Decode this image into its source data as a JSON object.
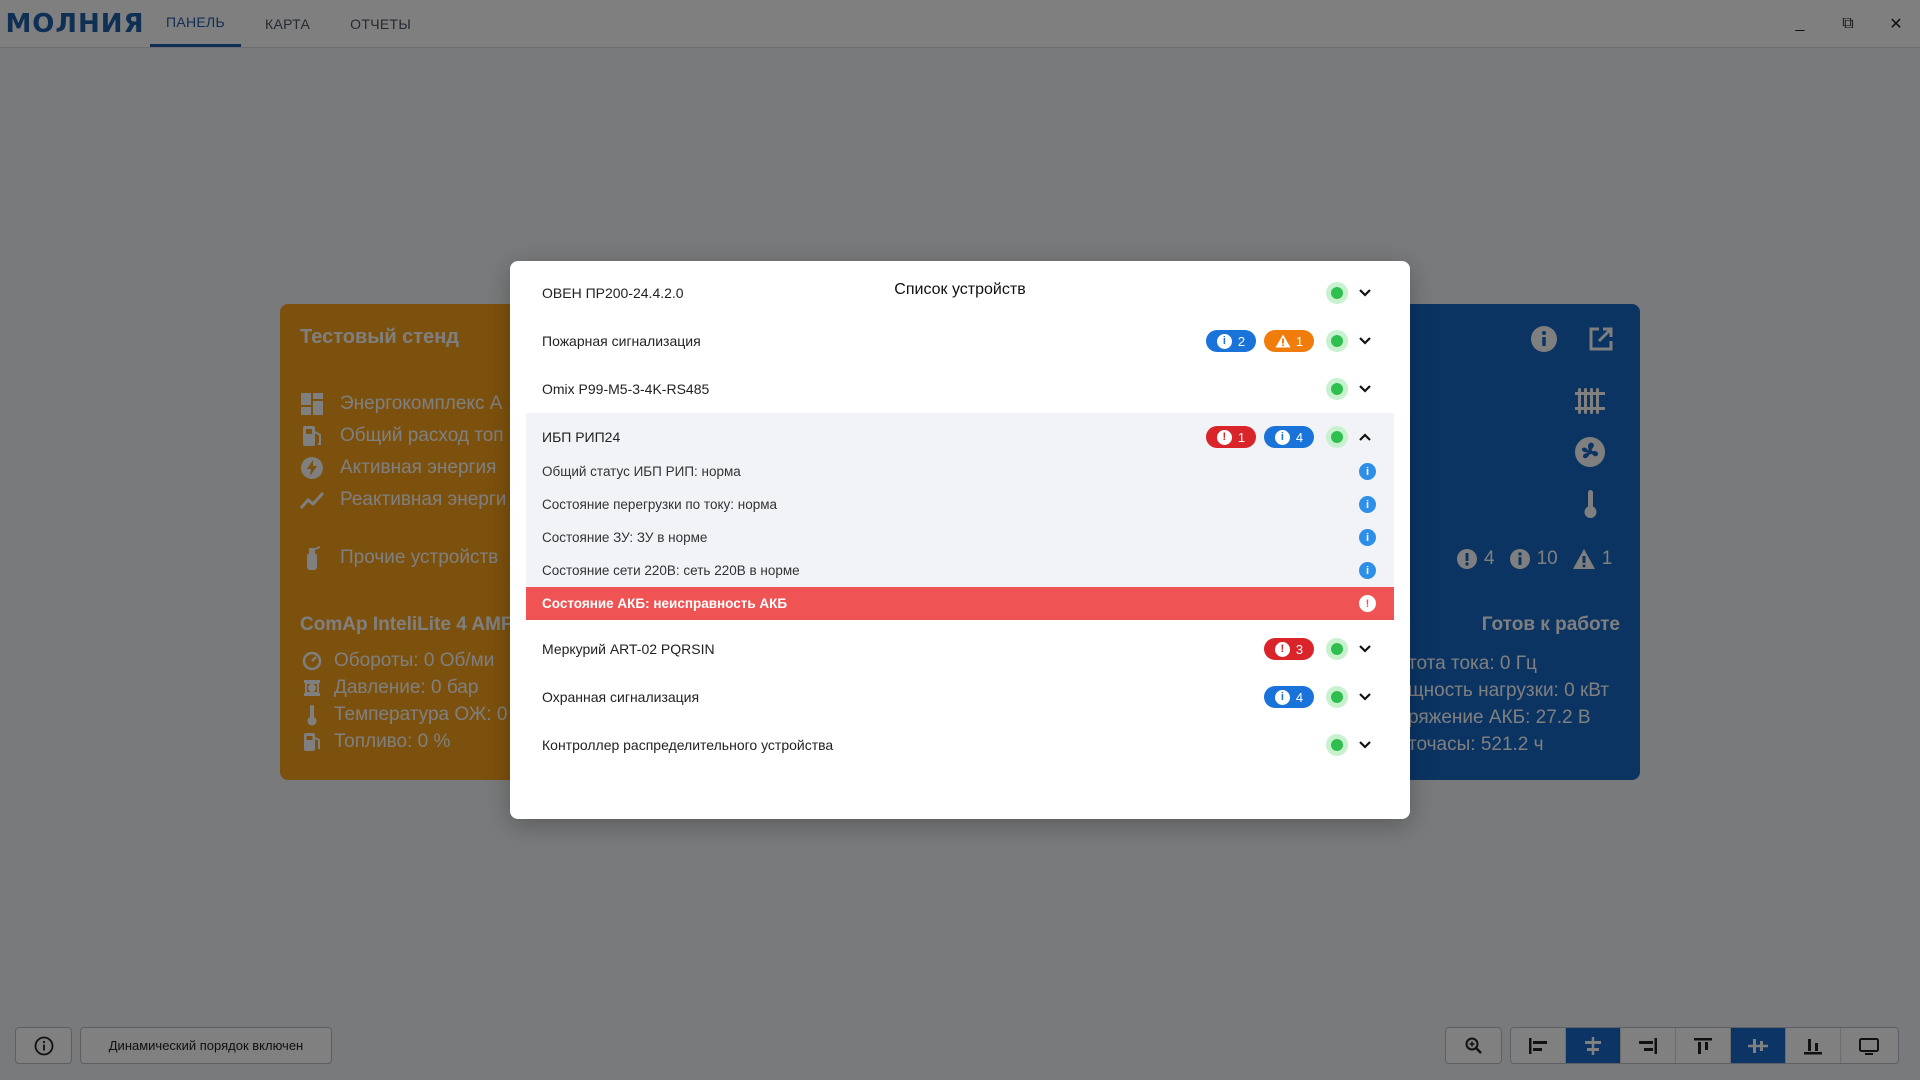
{
  "app": {
    "logo": "МОЛНИЯ",
    "tabs": [
      "ПАНЕЛЬ",
      "КАРТА",
      "ОТЧЕТЫ"
    ],
    "active_tab": 0,
    "window_controls": {
      "minimize": "_",
      "maximize": "⧉",
      "close": "✕"
    }
  },
  "card_left": {
    "title": "Тестовый стенд",
    "rows": [
      {
        "icon": "grid-icon",
        "text": "Энергокомплекс А"
      },
      {
        "icon": "fuel-icon",
        "text": "Общий расход топ"
      },
      {
        "icon": "energy-icon",
        "text": "Активная энергия"
      },
      {
        "icon": "trend-icon",
        "text": "Реактивная энерги"
      },
      {
        "icon": "extinguisher-icon",
        "text": "Прочие устройств"
      }
    ],
    "subtitle": "ComAp InteliLite 4 AMF",
    "params": [
      {
        "icon": "gauge-icon",
        "text": "Обороты: 0 Об/ми"
      },
      {
        "icon": "pressure-icon",
        "text": "Давление: 0 бар"
      },
      {
        "icon": "thermometer-icon",
        "text": "Температура ОЖ: 0"
      },
      {
        "icon": "fuel-icon",
        "text": "Топливо: 0 %"
      }
    ]
  },
  "card_right": {
    "counters": {
      "errors": "4",
      "info": "10",
      "warnings": "1"
    },
    "status": "Готов к работе",
    "params": [
      "тота тока: 0 Гц",
      "щность нагрузки: 0 кВт",
      "ряжение АКБ: 27.2 В",
      "точасы: 521.2 ч"
    ]
  },
  "modal": {
    "title": "Список устройств",
    "devices": [
      {
        "name": "ОВЕН ПР200-24.4.2.0",
        "badges": [],
        "expanded": false
      },
      {
        "name": "Пожарная сигнализация",
        "badges": [
          {
            "type": "info",
            "count": "2"
          },
          {
            "type": "warning",
            "count": "1"
          }
        ],
        "expanded": false
      },
      {
        "name": "Omix P99-M5-3-4K-RS485",
        "badges": [],
        "expanded": false
      },
      {
        "name": "ИБП РИП24",
        "badges": [
          {
            "type": "error",
            "count": "1"
          },
          {
            "type": "info",
            "count": "4"
          }
        ],
        "expanded": true
      },
      {
        "name": "Меркурий ART-02 PQRSIN",
        "badges": [
          {
            "type": "error",
            "count": "3"
          }
        ],
        "expanded": false
      },
      {
        "name": "Охранная сигнализация",
        "badges": [
          {
            "type": "info",
            "count": "4"
          }
        ],
        "expanded": false
      },
      {
        "name": "Контроллер распределительного устройства",
        "badges": [],
        "expanded": false
      }
    ],
    "events": [
      {
        "text": "Общий статус ИБП РИП: норма",
        "level": "info"
      },
      {
        "text": "Состояние перегрузки по току: норма",
        "level": "info"
      },
      {
        "text": "Состояние ЗУ: ЗУ в норме",
        "level": "info"
      },
      {
        "text": "Состояние сети 220В: сеть 220В в норме",
        "level": "info"
      },
      {
        "text": "Состояние АКБ: неисправность АКБ",
        "level": "error"
      }
    ]
  },
  "footer": {
    "dynamic_order_label": "Динамический порядок включен",
    "active_align_buttons": [
      "align-center-h",
      "align-center-v"
    ]
  },
  "colors": {
    "brand": "#1f5fa8",
    "card_orange": "#f8a21b",
    "card_blue": "#1768c7",
    "info": "#1a73d9",
    "error": "#d9252a",
    "warning": "#f07c0c",
    "ok": "#2fbf4e",
    "alert_row": "#f05353"
  }
}
